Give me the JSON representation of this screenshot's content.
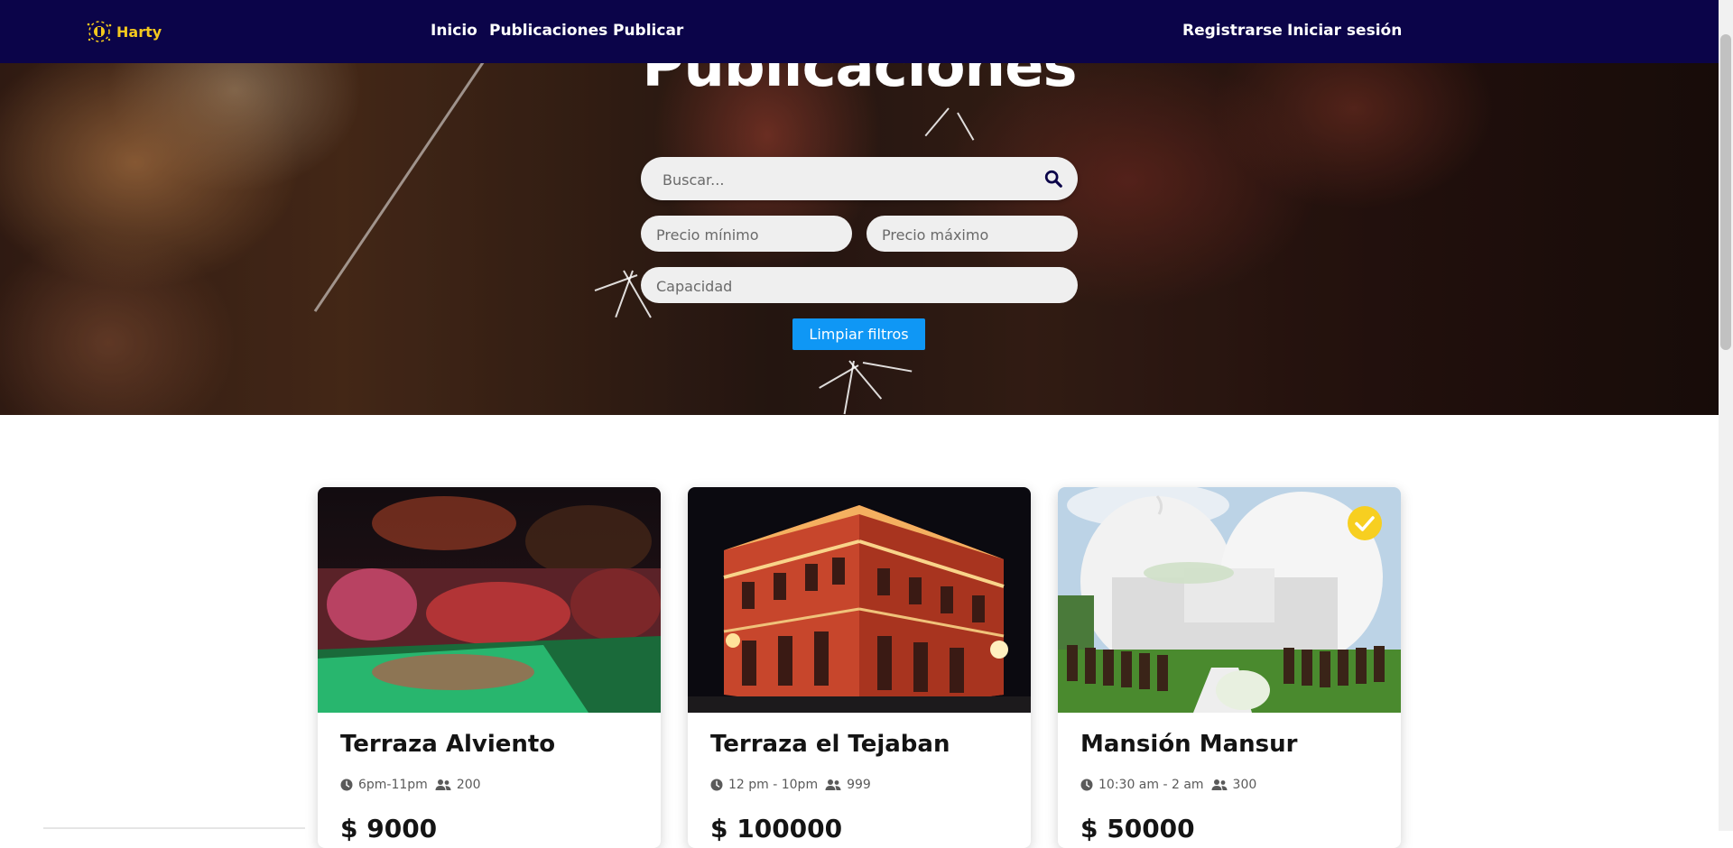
{
  "navbar": {
    "brand": "Harty",
    "links": [
      "Inicio",
      "Publicaciones",
      "Publicar"
    ],
    "register": "Registrarse",
    "login": "Iniciar sesión"
  },
  "hero": {
    "title": "Publicaciones",
    "search_placeholder": "Buscar...",
    "min_price_placeholder": "Precio mínimo",
    "max_price_placeholder": "Precio máximo",
    "capacity_placeholder": "Capacidad",
    "clear_button": "Limpiar filtros"
  },
  "cards": [
    {
      "title": "Terraza Alviento",
      "hours": "6pm-11pm",
      "capacity": "200",
      "price": "$ 9000",
      "verified": false
    },
    {
      "title": "Terraza el Tejaban",
      "hours": "12 pm - 10pm",
      "capacity": "999",
      "price": "$ 100000",
      "verified": false
    },
    {
      "title": "Mansión Mansur",
      "hours": "10:30 am - 2 am",
      "capacity": "300",
      "price": "$ 50000",
      "verified": true
    }
  ],
  "colors": {
    "navbar_bg": "#0b0449",
    "brand_yellow": "#f4c81e",
    "button_blue": "#0f97f5",
    "verified_badge": "#f7cf20"
  },
  "icons": [
    "search-icon",
    "clock-icon",
    "people-icon",
    "check-badge-icon",
    "logo-icon"
  ]
}
